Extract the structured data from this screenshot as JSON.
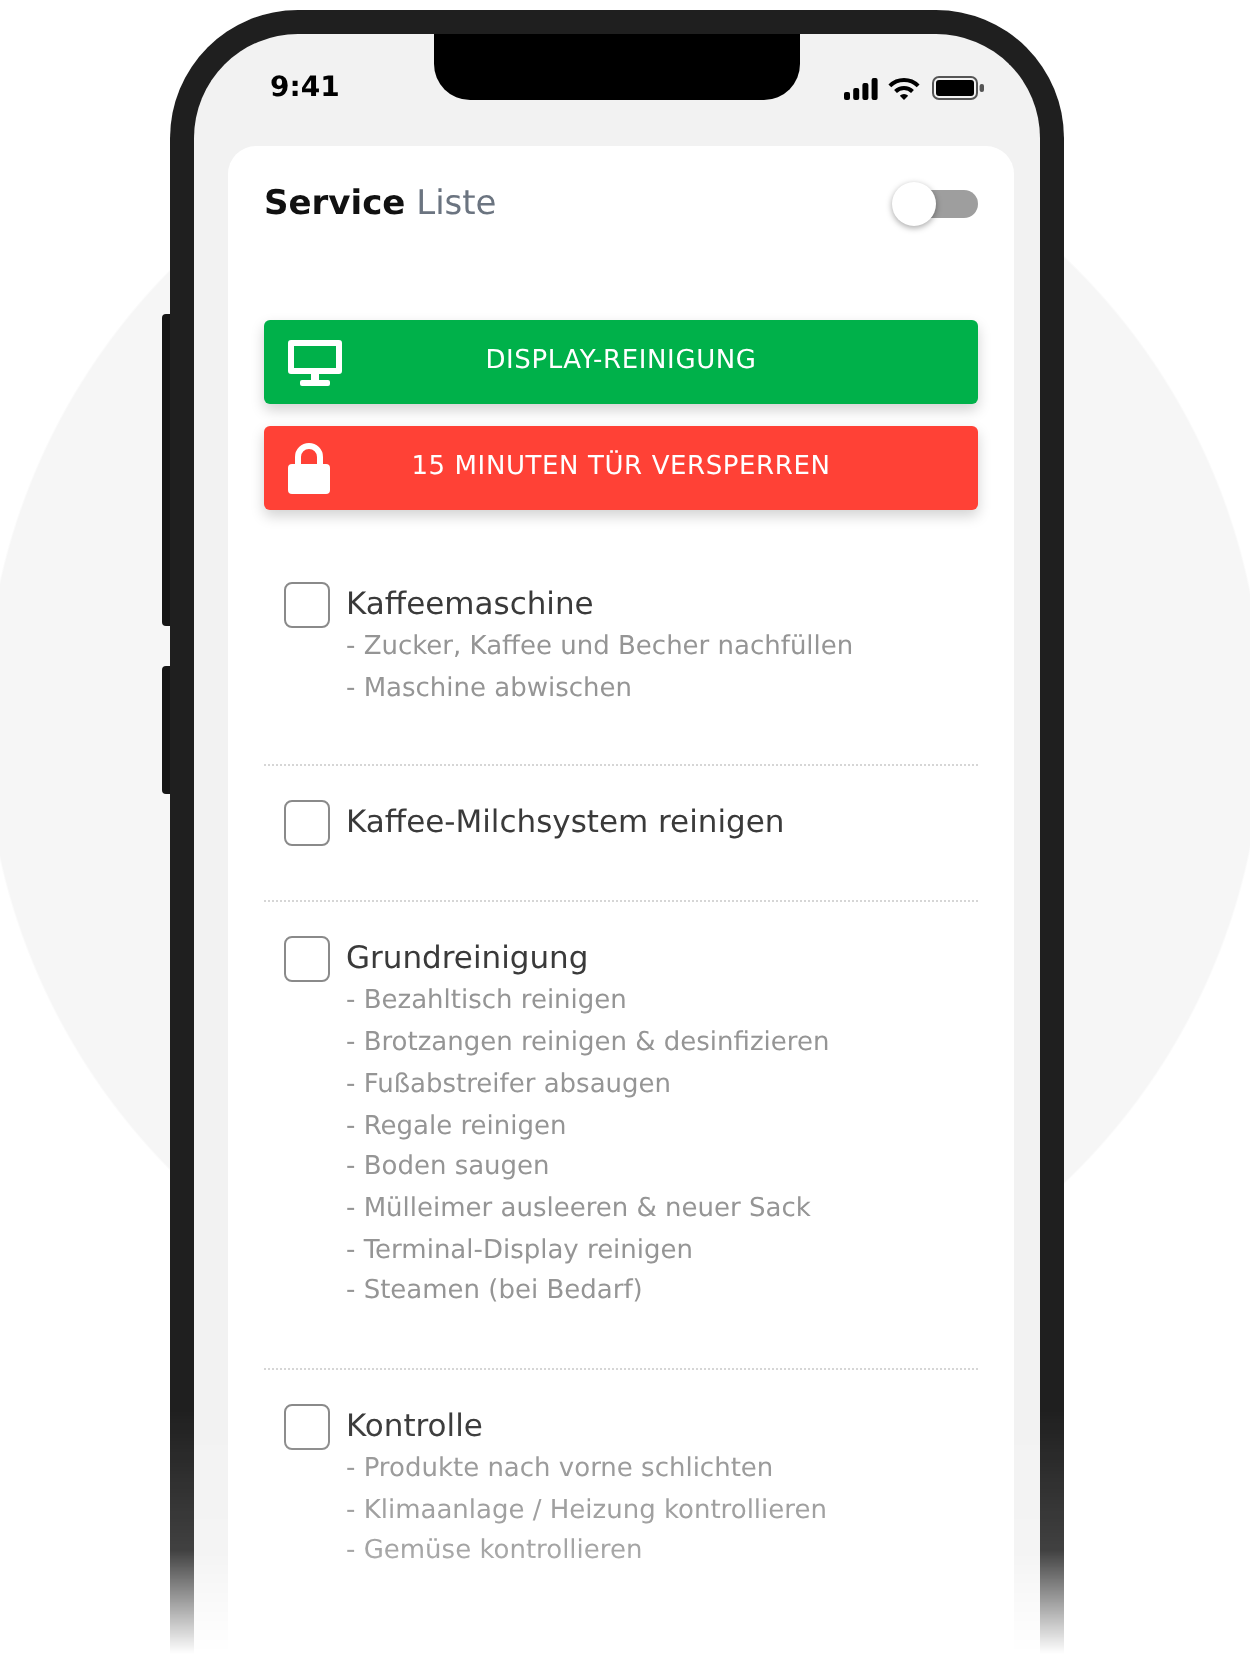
{
  "status_bar": {
    "time": "9:41"
  },
  "header": {
    "title": "**Service** Liste",
    "toggle": {
      "on": false
    }
  },
  "buttons": [
    {
      "label": "DISPLAY-REINIGUNG",
      "kind": "cleaning",
      "color": "#00b14a"
    },
    {
      "label": "15 MINUTEN TÜR VERSPERREN",
      "kind": "locking",
      "color": "#ff4136"
    }
  ],
  "checklist": [
    {
      "title": "Kaffeemaschine",
      "checked": false,
      "steps": [
        "- Zucker, Kaffee und Becher nachfüllen",
        "- Maschine abwischen"
      ]
    },
    {
      "title": "Kaffee-Milchsystem reinigen",
      "checked": false
    },
    {
      "title": "Grundreinigung",
      "checked": false,
      "steps": [
        "- Bezahltisch reinigen",
        "- Brotzangen reinigen & desinfizieren",
        "- Fußabstreifer absaugen",
        "- Regale reinigen",
        "- Boden saugen",
        "- Mülleimer ausleeren & neuer Sack",
        "- Terminal-Display reinigen",
        "- Steamen (bei Bedarf)"
      ]
    },
    {
      "title": "Kontrolle",
      "checked": false,
      "steps": [
        "- Produkte nach vorne schlichten",
        "- Klimaanlage / Heizung kontrollieren",
        "- Gemüse kontrollieren"
      ]
    }
  ]
}
